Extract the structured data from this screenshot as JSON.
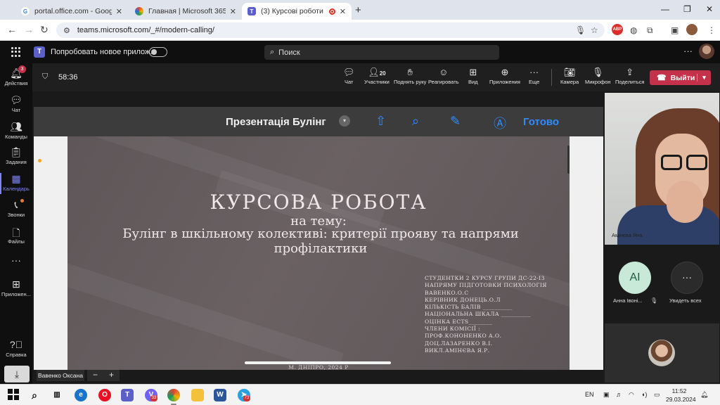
{
  "browser": {
    "tabs": [
      {
        "title": "portal.office.com - Google Search",
        "favicon": "google-icon"
      },
      {
        "title": "Главная | Microsoft 365",
        "favicon": "m365-icon"
      },
      {
        "title": "(3) Курсові роботи (захист)",
        "favicon": "teams-icon",
        "recording": true
      }
    ],
    "url": "teams.microsoft.com/_#/modern-calling/",
    "extension_badge": "ABP"
  },
  "teams": {
    "logo": "T",
    "try_new_label": "Попробовать новое прилож...",
    "search_placeholder": "Поиск"
  },
  "rail": {
    "items": [
      {
        "label": "Действия",
        "icon": "bell-icon",
        "badge": "3"
      },
      {
        "label": "Чат",
        "icon": "chat-icon"
      },
      {
        "label": "Команды",
        "icon": "teams-icon"
      },
      {
        "label": "Задания",
        "icon": "assignments-icon"
      },
      {
        "label": "Календарь",
        "icon": "calendar-icon",
        "active": true
      },
      {
        "label": "Звонки",
        "icon": "phone-icon",
        "dot": true
      },
      {
        "label": "Файлы",
        "icon": "file-icon"
      },
      {
        "label": "Приложен...",
        "icon": "apps-icon"
      },
      {
        "label": "Справка",
        "icon": "help-icon"
      }
    ]
  },
  "meeting": {
    "timer": "58:36",
    "participants_count": "20",
    "toolbar": {
      "chat": "Чат",
      "participants": "Участники",
      "raise_hand": "Поднять руку",
      "react": "Реагировать",
      "view": "Вид",
      "apps": "Приложения",
      "more": "Еще",
      "camera": "Камера",
      "mic": "Микрофон",
      "share": "Поделиться",
      "leave": "Выйти"
    }
  },
  "presentation": {
    "title": "Презентація Булінг",
    "done_label": "Готово",
    "slide": {
      "title": "КУРСОВА РОБОТА",
      "subtitle1": "на тему:",
      "subtitle2": "Булінг в шкільному колективі: критерії прояву та напрями профілактики",
      "info_lines": [
        "СТУДЕНТКИ 2 КУРСУ ГРУПИ ДС-22-ІЗ",
        "НАПРЯМУ ПІДГОТОВКИ ПСИХОЛОГІЯ",
        "ВАВЕНКО.О.С",
        "КЕРІВНИК ДОНЕЦЬ.О.Л",
        "КІЛЬКІСТЬ БАЛІВ __________",
        "НАЦІОНАЛЬНА ШКАЛА __________",
        "ОЦІНКА ECTS________",
        "ЧЛЕНИ КОМІСІЇ :",
        "ПРОФ.КОНОНЕНКО А.О.",
        "ДОЦ.ЛАЗАРЕНКО В.І.",
        "ВИКЛ.АМІНЄВА Я.Р."
      ],
      "footer": "М. ДНІПРО, 2024 Р"
    },
    "presenter_name": "Вавенко Оксана",
    "zoom_minus": "−",
    "zoom_plus": "+"
  },
  "participants": {
    "video_name": "Амінєва Яна",
    "ai_initials": "AI",
    "ai_name": "Анна Івоні...",
    "see_all": "Увидеть всех"
  },
  "taskbar": {
    "lang": "EN",
    "time": "11:52",
    "date": "29.03.2024",
    "viber_badge": "33",
    "telegram_badge": "73"
  }
}
